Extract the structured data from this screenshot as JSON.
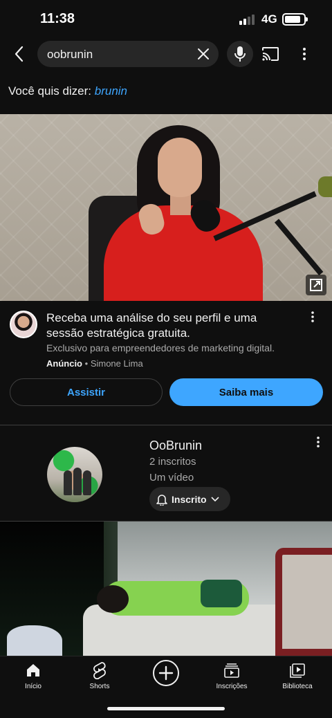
{
  "status_bar": {
    "time": "11:38",
    "network": "4G"
  },
  "search": {
    "query": "oobrunin"
  },
  "suggestion": {
    "prefix": "Você quis dizer:",
    "term": "brunin"
  },
  "ad": {
    "title": "Receba uma análise do seu perfil e uma sessão estratégica gratuita.",
    "description": "Exclusivo para empreendedores de marketing digital.",
    "badge": "Anúncio",
    "separator": "•",
    "advertiser": "Simone Lima",
    "watch_label": "Assistir",
    "learn_more_label": "Saiba mais"
  },
  "channel": {
    "name": "OoBrunin",
    "subscribers": "2 inscritos",
    "videos": "Um vídeo",
    "subscribe_state": "Inscrito"
  },
  "bottom_nav": {
    "home": "Início",
    "shorts": "Shorts",
    "subscriptions": "Inscrições",
    "library": "Biblioteca"
  },
  "colors": {
    "background": "#0f0f0f",
    "accent": "#3ea6ff",
    "surface": "#272727"
  },
  "icons": [
    "back-arrow-icon",
    "clear-icon",
    "mic-icon",
    "cast-icon",
    "more-vert-icon",
    "external-link-icon",
    "bell-icon",
    "chevron-down-icon",
    "home-icon",
    "shorts-icon",
    "create-icon",
    "subscriptions-icon",
    "library-icon"
  ]
}
